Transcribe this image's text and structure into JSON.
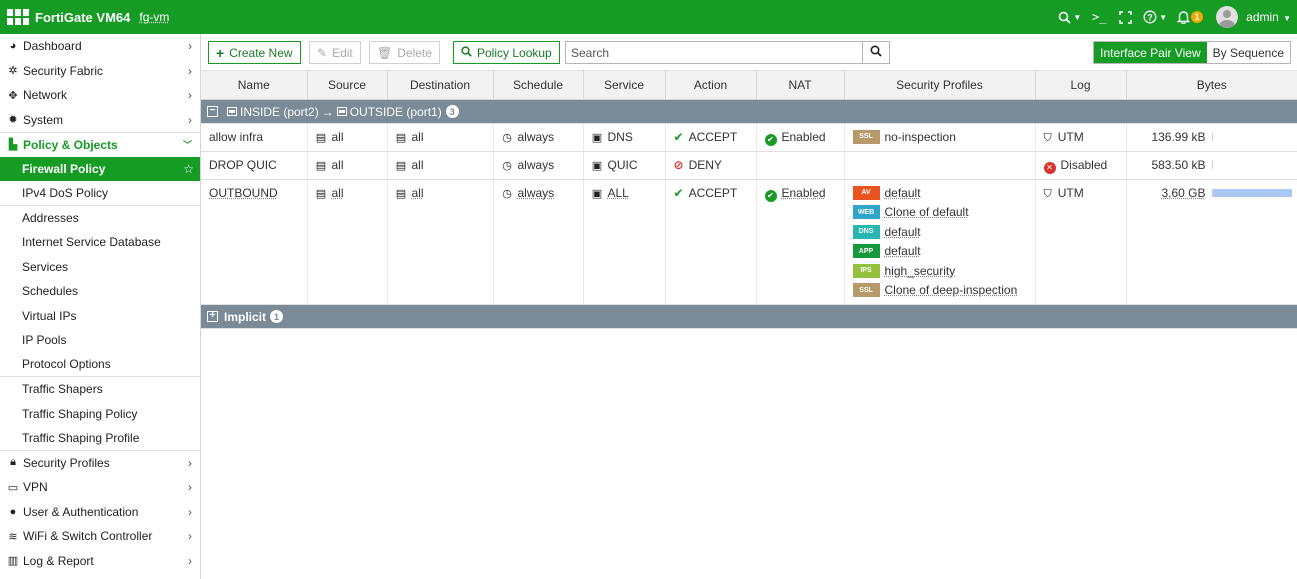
{
  "header": {
    "app_title": "FortiGate VM64",
    "hostname": "fg-vm",
    "notification_count": "1",
    "user": "admin"
  },
  "sidebar": {
    "items_top": [
      {
        "label": "Dashboard",
        "icon": "dashboard-icon"
      },
      {
        "label": "Security Fabric",
        "icon": "security-fabric-icon"
      },
      {
        "label": "Network",
        "icon": "network-icon"
      },
      {
        "label": "System",
        "icon": "gear-icon"
      }
    ],
    "active_group": {
      "label": "Policy & Objects",
      "icon": "policy-icon"
    },
    "sub_items": [
      "Firewall Policy",
      "IPv4 DoS Policy",
      "Addresses",
      "Internet Service Database",
      "Services",
      "Schedules",
      "Virtual IPs",
      "IP Pools",
      "Protocol Options",
      "Traffic Shapers",
      "Traffic Shaping Policy",
      "Traffic Shaping Profile"
    ],
    "items_bottom": [
      {
        "label": "Security Profiles",
        "icon": "lock-icon"
      },
      {
        "label": "VPN",
        "icon": "laptop-icon"
      },
      {
        "label": "User & Authentication",
        "icon": "user-icon"
      },
      {
        "label": "WiFi & Switch Controller",
        "icon": "wifi-icon"
      },
      {
        "label": "Log & Report",
        "icon": "bar-chart-icon"
      }
    ]
  },
  "toolbar": {
    "create_new": "Create New",
    "edit": "Edit",
    "delete": "Delete",
    "policy_lookup": "Policy Lookup",
    "search_placeholder": "Search",
    "view_interface_pair": "Interface Pair View",
    "view_by_sequence": "By Sequence"
  },
  "table": {
    "columns": [
      "Name",
      "Source",
      "Destination",
      "Schedule",
      "Service",
      "Action",
      "NAT",
      "Security Profiles",
      "Log",
      "Bytes"
    ],
    "groups": [
      {
        "label_src": "INSIDE (port2)",
        "arrow": "→",
        "label_dst": "OUTSIDE (port1)",
        "count": "3",
        "expanded": true,
        "rows": [
          {
            "name": "allow infra",
            "source": "all",
            "destination": "all",
            "schedule": "always",
            "service": "DNS",
            "action": "ACCEPT",
            "nat": "Enabled",
            "profiles": [
              {
                "tag": "SSL",
                "color": "#b89a6a",
                "name": "no-inspection"
              }
            ],
            "log": "UTM",
            "bytes": "136.99 kB",
            "bytes_fraction": 0.0
          },
          {
            "name": "DROP QUIC",
            "source": "all",
            "destination": "all",
            "schedule": "always",
            "service": "QUIC",
            "action": "DENY",
            "nat": "",
            "profiles": [],
            "log": "Disabled",
            "bytes": "583.50 kB",
            "bytes_fraction": 0.0
          },
          {
            "name": "OUTBOUND",
            "source": "all",
            "destination": "all",
            "schedule": "always",
            "service": "ALL",
            "action": "ACCEPT",
            "nat": "Enabled",
            "profiles": [
              {
                "tag": "AV",
                "color": "#e8531f",
                "name": "default"
              },
              {
                "tag": "WEB",
                "color": "#2ea6c9",
                "name": "Clone of default"
              },
              {
                "tag": "DNS",
                "color": "#27b7b0",
                "name": "default"
              },
              {
                "tag": "APP",
                "color": "#159a3b",
                "name": "default"
              },
              {
                "tag": "IPS",
                "color": "#93c13e",
                "name": "high_security"
              },
              {
                "tag": "SSL",
                "color": "#b89a6a",
                "name": "Clone of deep-inspection"
              }
            ],
            "log": "UTM",
            "bytes": "3.60 GB",
            "bytes_fraction": 1.0
          }
        ]
      },
      {
        "label_src": "Implicit",
        "count": "1",
        "expanded": false,
        "rows": []
      }
    ]
  },
  "colors": {
    "brand": "#169b25",
    "group_row": "#7a8b97",
    "bar_fill": "#a9c7f0"
  }
}
